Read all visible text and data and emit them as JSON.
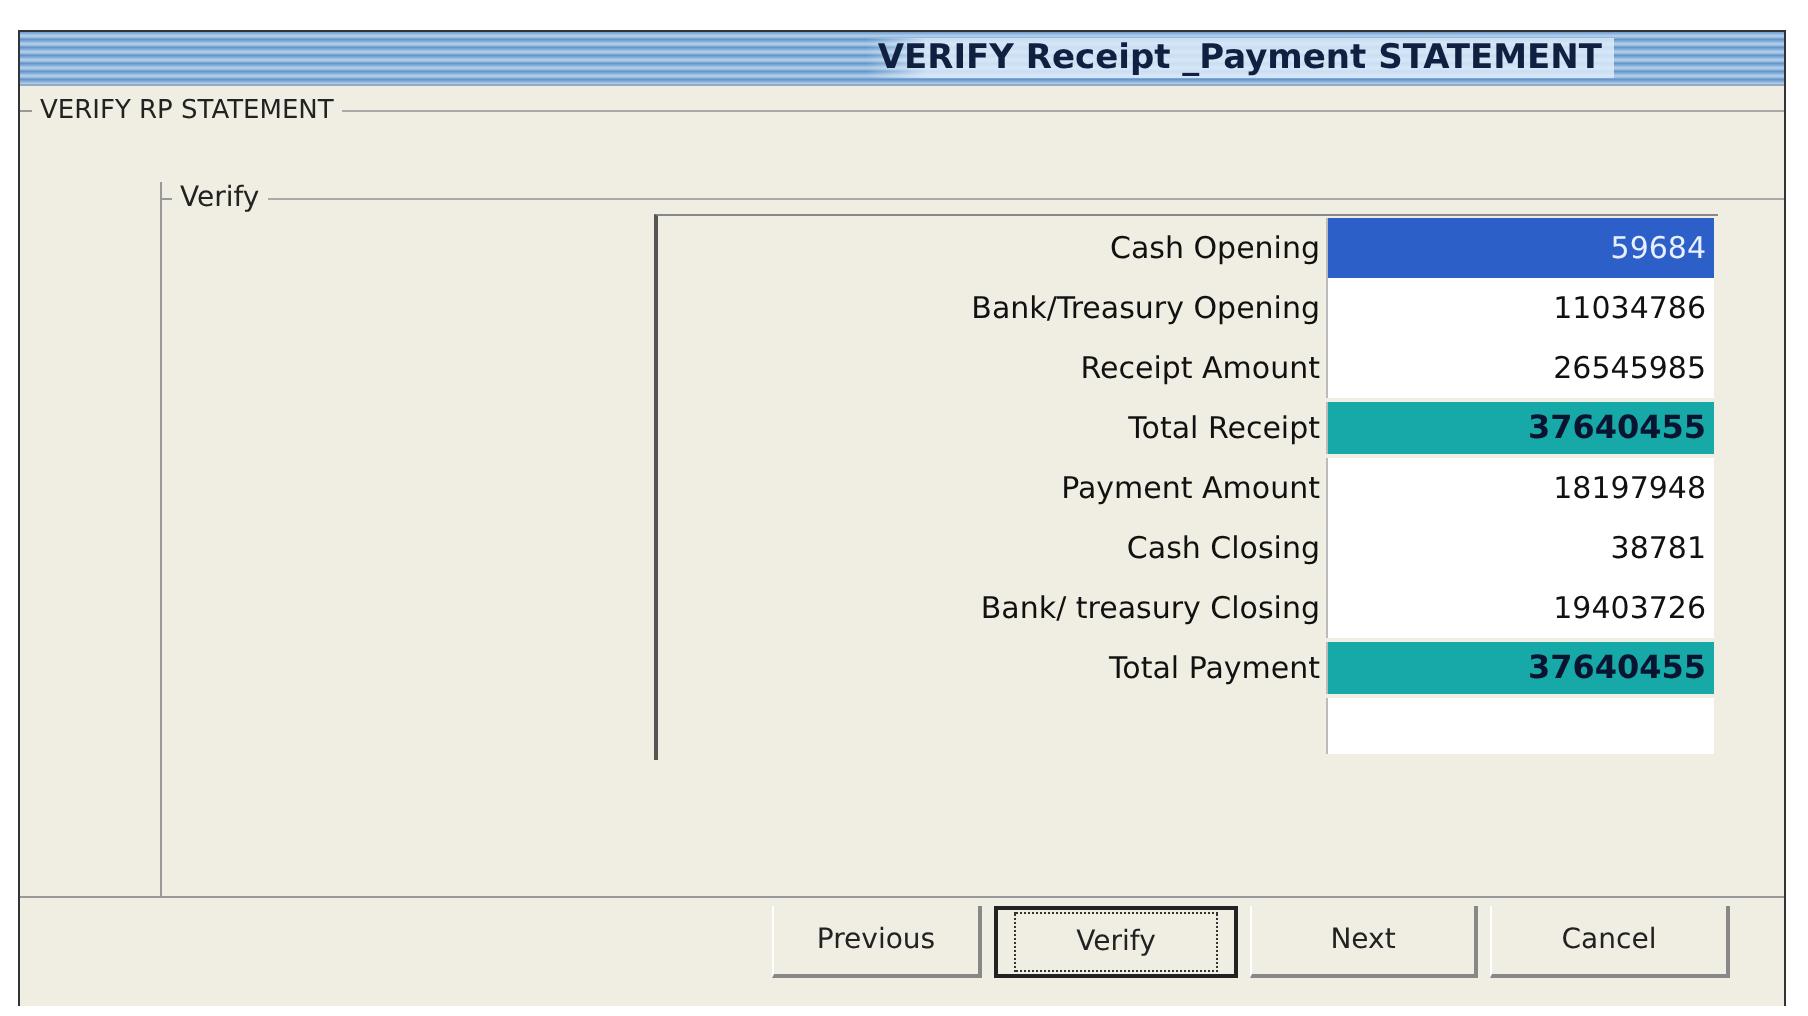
{
  "window": {
    "title": "VERIFY Receipt _Payment STATEMENT"
  },
  "outer_group": {
    "label": "VERIFY RP STATEMENT"
  },
  "inner_group": {
    "label": "Verify"
  },
  "rows": [
    {
      "label": "Cash Opening",
      "value": "59684",
      "kind": "plain",
      "selected": true
    },
    {
      "label": "Bank/Treasury Opening",
      "value": "11034786",
      "kind": "plain",
      "selected": false
    },
    {
      "label": "Receipt Amount",
      "value": "26545985",
      "kind": "plain",
      "selected": false
    },
    {
      "label": "Total Receipt",
      "value": "37640455",
      "kind": "total",
      "selected": false
    },
    {
      "label": "Payment Amount",
      "value": "18197948",
      "kind": "plain",
      "selected": false
    },
    {
      "label": "Cash Closing",
      "value": "38781",
      "kind": "plain",
      "selected": false
    },
    {
      "label": "Bank/ treasury Closing",
      "value": "19403726",
      "kind": "plain",
      "selected": false
    },
    {
      "label": "Total Payment",
      "value": "37640455",
      "kind": "total",
      "selected": false
    }
  ],
  "buttons": [
    {
      "label": "Previous",
      "focused": false
    },
    {
      "label": "Verify",
      "focused": true
    },
    {
      "label": "Next",
      "focused": false
    },
    {
      "label": "Cancel",
      "focused": false
    }
  ]
}
